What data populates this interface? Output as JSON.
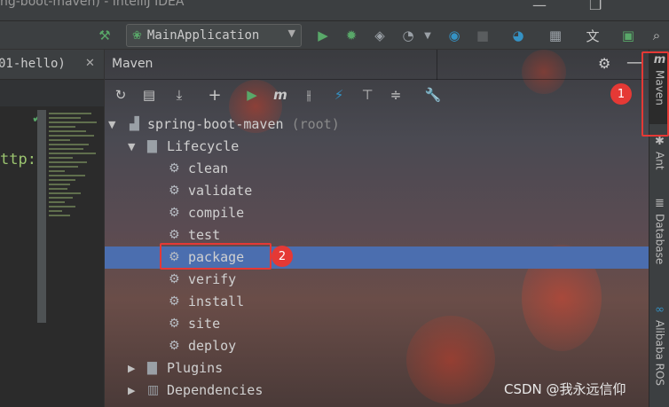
{
  "window": {
    "title": "ng-boot-maven) - IntelliJ IDEA",
    "minimize": "—",
    "restore": "❐"
  },
  "toolbar": {
    "run_config": "MainApplication"
  },
  "editor": {
    "tab_title": "01-hello)",
    "tab_close": "✕",
    "code_fragment": "ttp:/"
  },
  "maven_panel": {
    "title": "Maven"
  },
  "tree": {
    "project": {
      "name": "spring-boot-maven",
      "suffix": "(root)"
    },
    "lifecycle": {
      "label": "Lifecycle",
      "phases": [
        "clean",
        "validate",
        "compile",
        "test",
        "package",
        "verify",
        "install",
        "site",
        "deploy"
      ],
      "selected": "package"
    },
    "plugins": "Plugins",
    "dependencies": "Dependencies"
  },
  "annotations": {
    "badge1": "1",
    "badge2": "2"
  },
  "right_tool_windows": [
    "Maven",
    "Ant",
    "Database",
    "Alibaba ROS"
  ],
  "watermark": "CSDN @我永远信仰",
  "colors": {
    "selection": "#4b6eaf",
    "annotation_red": "#e53935",
    "run_green": "#59a869"
  }
}
